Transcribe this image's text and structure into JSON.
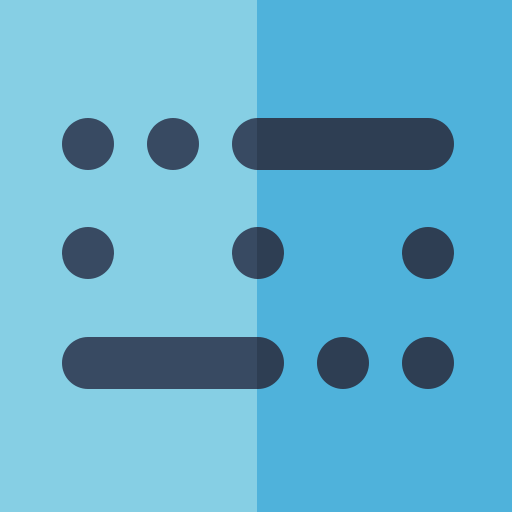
{
  "icon": {
    "name": "morse-code-icon",
    "rows": [
      [
        "dot",
        "dot",
        "dash"
      ],
      [
        "dot",
        "dot",
        "dot"
      ],
      [
        "dash",
        "dot",
        "dot"
      ]
    ]
  },
  "colors": {
    "background_left": "#86CFE4",
    "background_right": "#4FB2DB",
    "symbol_left": "#384A62",
    "symbol_right": "#2E3E53"
  }
}
